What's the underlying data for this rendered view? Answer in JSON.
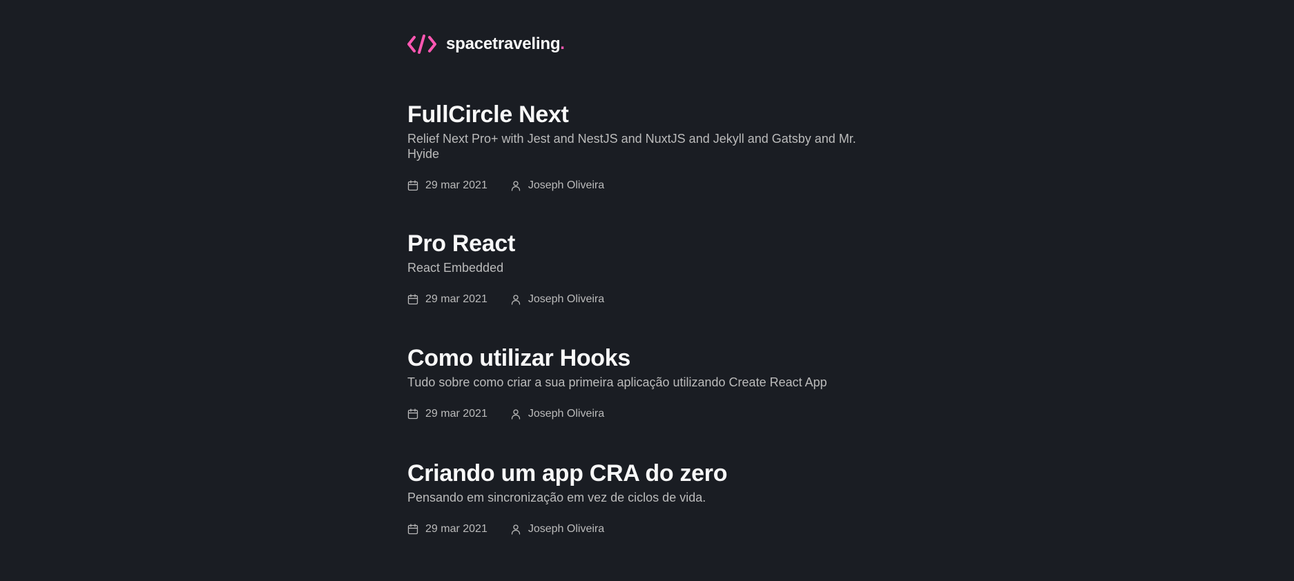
{
  "header": {
    "logo_text": "spacetraveling",
    "logo_dot": ".",
    "logo_icon": "code-icon",
    "accent_color": "#ff57b2"
  },
  "posts": [
    {
      "title": "FullCircle Next",
      "subtitle": "Relief Next Pro+ with Jest and NestJS and NuxtJS and Jekyll and Gatsby and Mr. Hyide",
      "date": "29 mar 2021",
      "author": "Joseph Oliveira"
    },
    {
      "title": "Pro React",
      "subtitle": "React Embedded",
      "date": "29 mar 2021",
      "author": "Joseph Oliveira"
    },
    {
      "title": "Como utilizar Hooks",
      "subtitle": "Tudo sobre como criar a sua primeira aplicação utilizando Create React App",
      "date": "29 mar 2021",
      "author": "Joseph Oliveira"
    },
    {
      "title": "Criando um app CRA do zero",
      "subtitle": "Pensando em sincronização em vez de ciclos de vida.",
      "date": "29 mar 2021",
      "author": "Joseph Oliveira"
    }
  ],
  "icons": {
    "date": "calendar-icon",
    "author": "user-icon"
  },
  "colors": {
    "background": "#1a1d23",
    "heading": "#f8f8f8",
    "body_text": "#bbbbbb"
  }
}
